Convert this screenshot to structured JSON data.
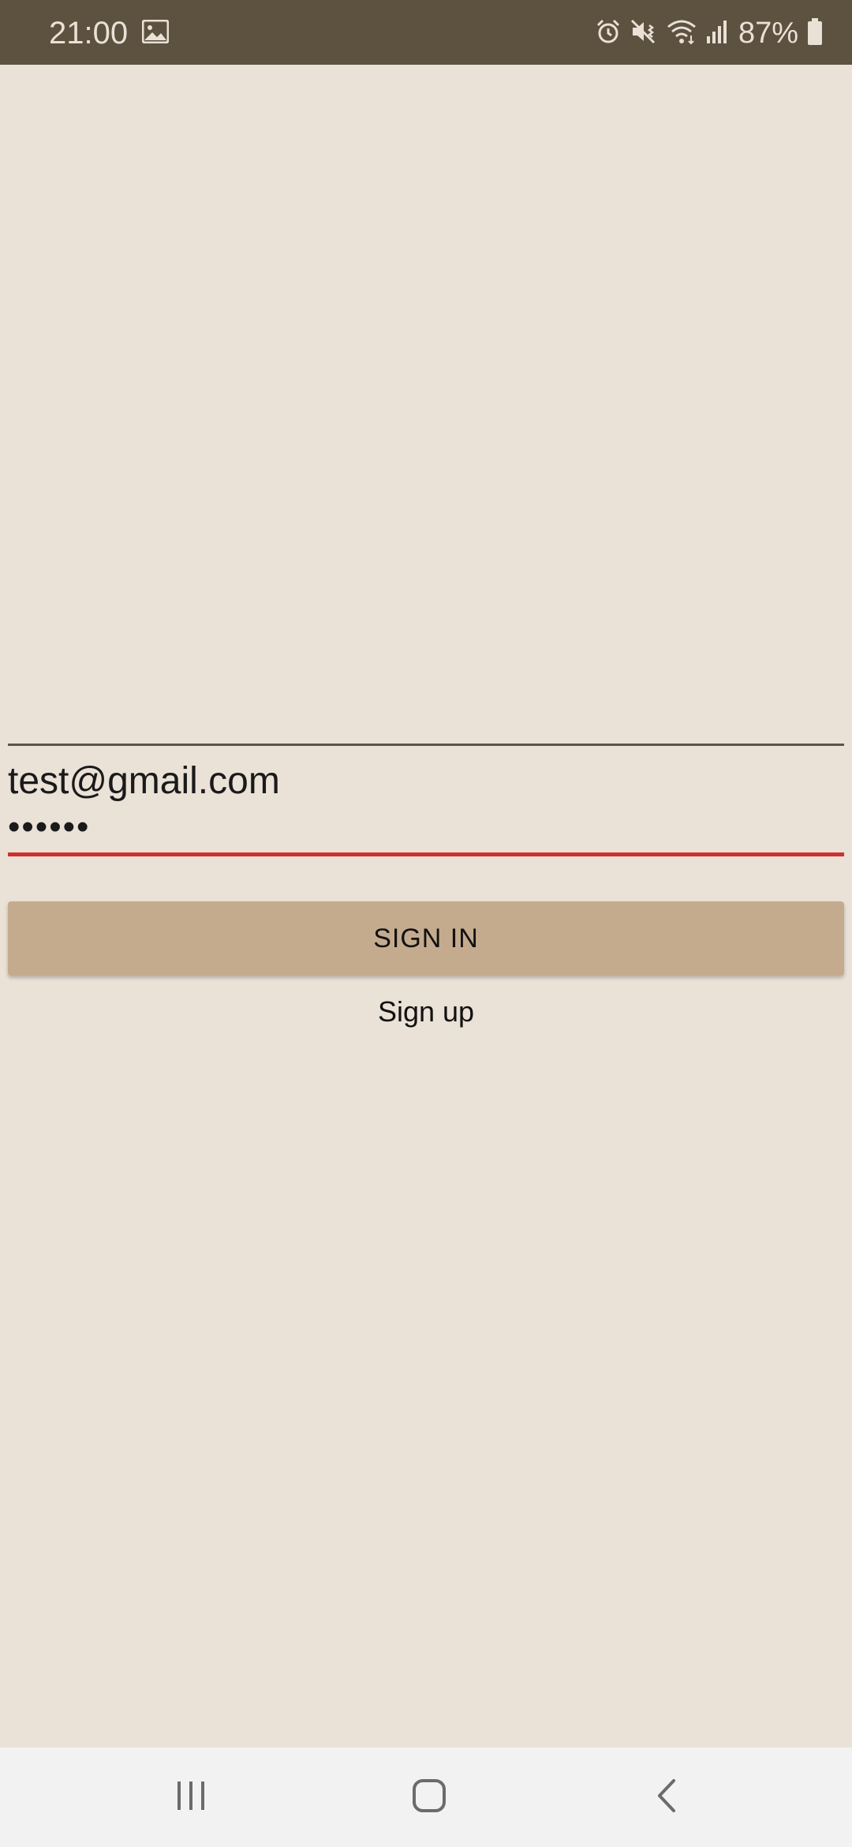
{
  "status_bar": {
    "time": "21:00",
    "battery_percent": "87%",
    "icons": [
      "gallery-icon",
      "alarm-icon",
      "mute-vibrate-icon",
      "wifi-icon",
      "signal-icon",
      "battery-icon"
    ]
  },
  "login": {
    "email_value": "test@gmail.com",
    "password_masked": "••••••",
    "signin_label": "SIGN IN",
    "signup_label": "Sign up"
  },
  "colors": {
    "background": "#EAE1D7",
    "status_bar": "#5D5140",
    "button": "#C5AB8E",
    "error_underline": "#D0302E"
  },
  "nav_bar": {
    "buttons": [
      "recent-apps-icon",
      "home-icon",
      "back-icon"
    ]
  }
}
